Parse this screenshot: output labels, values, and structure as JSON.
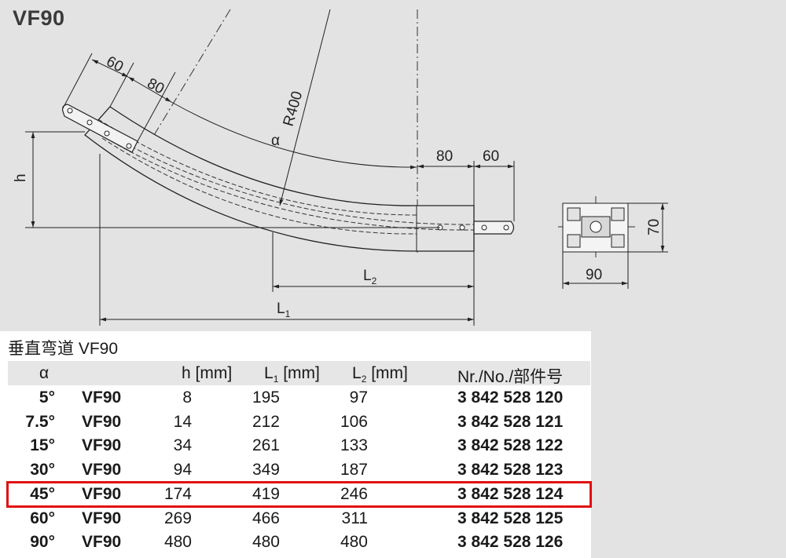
{
  "page_title": "VF90",
  "drawing": {
    "dim_60_top": "60",
    "dim_80_top": "80",
    "radius_label": "R400",
    "angle_label": "α",
    "height_label": "h",
    "dim_80_right": "80",
    "dim_60_right": "60",
    "l2_label": "L",
    "l2_sub": "2",
    "l1_label": "L",
    "l1_sub": "1",
    "profile_height": "70",
    "profile_width": "90"
  },
  "table": {
    "caption": "垂直弯道 VF90",
    "headers": {
      "angle": "α",
      "h": "h [mm]",
      "l1_prefix": "L",
      "l1_sub": "1",
      "l1_suffix": " [mm]",
      "l2_prefix": "L",
      "l2_sub": "2",
      "l2_suffix": " [mm]",
      "nr": "Nr./No./部件号"
    },
    "rows": [
      {
        "angle": "5°",
        "type": "VF90",
        "h": "8",
        "l1": "195",
        "l2": "97",
        "nr": "3 842 528 120"
      },
      {
        "angle": "7.5°",
        "type": "VF90",
        "h": "14",
        "l1": "212",
        "l2": "106",
        "nr": "3 842 528 121"
      },
      {
        "angle": "15°",
        "type": "VF90",
        "h": "34",
        "l1": "261",
        "l2": "133",
        "nr": "3 842 528 122"
      },
      {
        "angle": "30°",
        "type": "VF90",
        "h": "94",
        "l1": "349",
        "l2": "187",
        "nr": "3 842 528 123"
      },
      {
        "angle": "45°",
        "type": "VF90",
        "h": "174",
        "l1": "419",
        "l2": "246",
        "nr": "3 842 528 124"
      },
      {
        "angle": "60°",
        "type": "VF90",
        "h": "269",
        "l1": "466",
        "l2": "311",
        "nr": "3 842 528 125"
      },
      {
        "angle": "90°",
        "type": "VF90",
        "h": "480",
        "l1": "480",
        "l2": "480",
        "nr": "3 842 528 126"
      }
    ],
    "highlight_color": "#e01010"
  }
}
